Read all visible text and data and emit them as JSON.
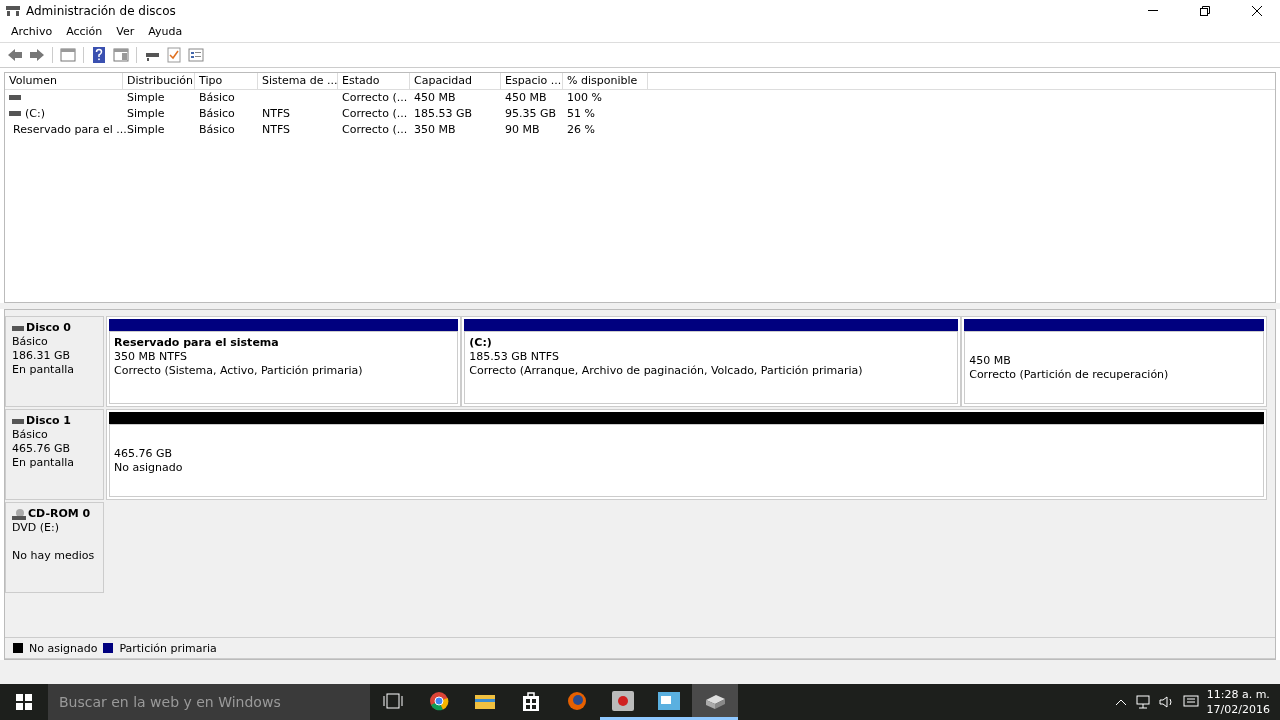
{
  "window": {
    "title": "Administración de discos"
  },
  "menu": [
    "Archivo",
    "Acción",
    "Ver",
    "Ayuda"
  ],
  "toolbar": [
    {
      "kind": "back",
      "disabled": false
    },
    {
      "kind": "forward",
      "disabled": false
    },
    {
      "kind": "sep"
    },
    {
      "kind": "panel"
    },
    {
      "kind": "sep"
    },
    {
      "kind": "help"
    },
    {
      "kind": "panel2"
    },
    {
      "kind": "sep"
    },
    {
      "kind": "drive"
    },
    {
      "kind": "check"
    },
    {
      "kind": "props"
    }
  ],
  "table": {
    "columns": [
      "Volumen",
      "Distribución",
      "Tipo",
      "Sistema de ...",
      "Estado",
      "Capacidad",
      "Espacio ...",
      "% disponible"
    ],
    "rows": [
      [
        "",
        "Simple",
        "Básico",
        "",
        "Correcto (...",
        "450 MB",
        "450 MB",
        "100 %"
      ],
      [
        "(C:)",
        "Simple",
        "Básico",
        "NTFS",
        "Correcto (...",
        "185.53 GB",
        "95.35 GB",
        "51 %"
      ],
      [
        "Reservado para el ...",
        "Simple",
        "Básico",
        "NTFS",
        "Correcto (...",
        "350 MB",
        "90 MB",
        "26 %"
      ]
    ]
  },
  "disks": [
    {
      "kind": "disk",
      "name": "Disco 0",
      "lines": [
        "Básico",
        "186.31 GB",
        "En pantalla"
      ],
      "partitions": [
        {
          "color": "#00007f",
          "title": "Reservado para el sistema",
          "size": "350 MB NTFS",
          "status": "Correcto (Sistema, Activo, Partición primaria)"
        },
        {
          "color": "#00007f",
          "title": "(C:)",
          "size": "185.53 GB NTFS",
          "status": "Correcto (Arranque, Archivo de paginación, Volcado, Partición primaria)"
        },
        {
          "color": "#00007f",
          "size": "450 MB",
          "status": "Correcto (Partición de recuperación)"
        }
      ]
    },
    {
      "kind": "disk",
      "name": "Disco 1",
      "lines": [
        "Básico",
        "465.76 GB",
        "En pantalla"
      ],
      "partitions": [
        {
          "color": "#000000",
          "size": "465.76 GB",
          "status": "No asignado"
        }
      ]
    },
    {
      "kind": "cdrom",
      "name": "CD-ROM 0",
      "lines": [
        "DVD (E:)",
        "No hay medios"
      ]
    }
  ],
  "legend": [
    {
      "color": "#000000",
      "label": "No asignado"
    },
    {
      "color": "#00007f",
      "label": "Partición primaria"
    }
  ],
  "taskbar": {
    "search_placeholder": "Buscar en la web y en Windows",
    "apps": [
      {
        "kind": "taskview",
        "running": false,
        "selected": false
      },
      {
        "kind": "chrome",
        "running": false,
        "selected": false
      },
      {
        "kind": "folder",
        "running": false,
        "selected": false
      },
      {
        "kind": "store",
        "running": false,
        "selected": false
      },
      {
        "kind": "firefox",
        "running": false,
        "selected": false
      },
      {
        "kind": "camera",
        "running": true,
        "selected": false
      },
      {
        "kind": "blueapp",
        "running": true,
        "selected": false
      },
      {
        "kind": "diskmgmt",
        "running": true,
        "selected": true
      }
    ],
    "time": "11:28 a. m.",
    "date": "17/02/2016"
  }
}
